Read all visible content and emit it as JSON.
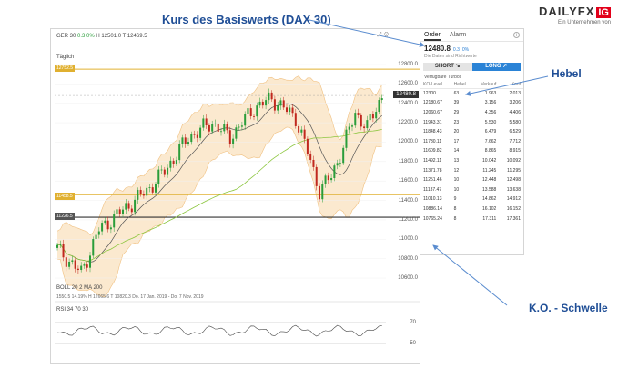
{
  "annotations": {
    "title": "Kurs des Basiswerts (DAX 30)",
    "hebel": "Hebel",
    "ko": "K.O. - Schwelle"
  },
  "logo": {
    "brand": "DAILYFX",
    "badge": "IG",
    "tagline": "Ein Unternehmen von"
  },
  "chart": {
    "symbol": "GER 30",
    "change": "0.3",
    "change_pct": "0%",
    "ohlc": "H 12501.0  T 12469.5",
    "period": "Täglich",
    "current_price": "12480.8",
    "price_axis": [
      "12800.0",
      "12600.0",
      "12400.0",
      "12200.0",
      "12000.0",
      "11800.0",
      "11600.0",
      "11400.0",
      "11200.0",
      "11000.0",
      "10800.0",
      "10600.0"
    ],
    "level_upper": "12752.5",
    "level_lower": "11458.5",
    "level_ko": "11226.5",
    "boll_line": "BOLL  20  2      MA  200",
    "indicator_values": "1550.5    14.19%    H 12665.6   T 10820.3    Do. 17 Jan. 2019 - Do. 7 Nov. 2019",
    "rsi_line": "RSI  34  70  30",
    "rsi_levels": [
      "70",
      "50"
    ]
  },
  "panel": {
    "tabs": [
      "Order",
      "Alarm"
    ],
    "price": "12480.8",
    "change": "0.3",
    "change_pct": "0%",
    "note": "Die Daten sind Richtwerte",
    "short_label": "SHORT",
    "long_label": "LONG",
    "section_title": "Verfügbare Turbos",
    "columns": [
      "KO-Level",
      "Hebel",
      "Verkauf",
      "Kauf"
    ],
    "rows": [
      [
        "12300",
        "63",
        "1.963",
        "2.013"
      ],
      [
        "12180.67",
        "39",
        "3.156",
        "3.206"
      ],
      [
        "12060.67",
        "29",
        "4.356",
        "4.406"
      ],
      [
        "11943.31",
        "23",
        "5.530",
        "5.580"
      ],
      [
        "11848.43",
        "20",
        "6.479",
        "6.529"
      ],
      [
        "11730.11",
        "17",
        "7.662",
        "7.712"
      ],
      [
        "11609.82",
        "14",
        "8.865",
        "8.915"
      ],
      [
        "11492.11",
        "13",
        "10.042",
        "10.092"
      ],
      [
        "11371.78",
        "12",
        "11.245",
        "11.295"
      ],
      [
        "11251.46",
        "10",
        "12.448",
        "12.498"
      ],
      [
        "11137.47",
        "10",
        "13.588",
        "13.638"
      ],
      [
        "11010.13",
        "9",
        "14.862",
        "14.912"
      ],
      [
        "10886.14",
        "8",
        "16.102",
        "16.152"
      ],
      [
        "10765.24",
        "8",
        "17.311",
        "17.361"
      ]
    ]
  },
  "colors": {
    "accent": "#1f4e96",
    "candle_up": "#2a9d3a",
    "candle_down": "#c0281e",
    "level_gold": "#e0b030",
    "long_button": "#2a83d6",
    "band_fill": "#fbe9cf"
  }
}
